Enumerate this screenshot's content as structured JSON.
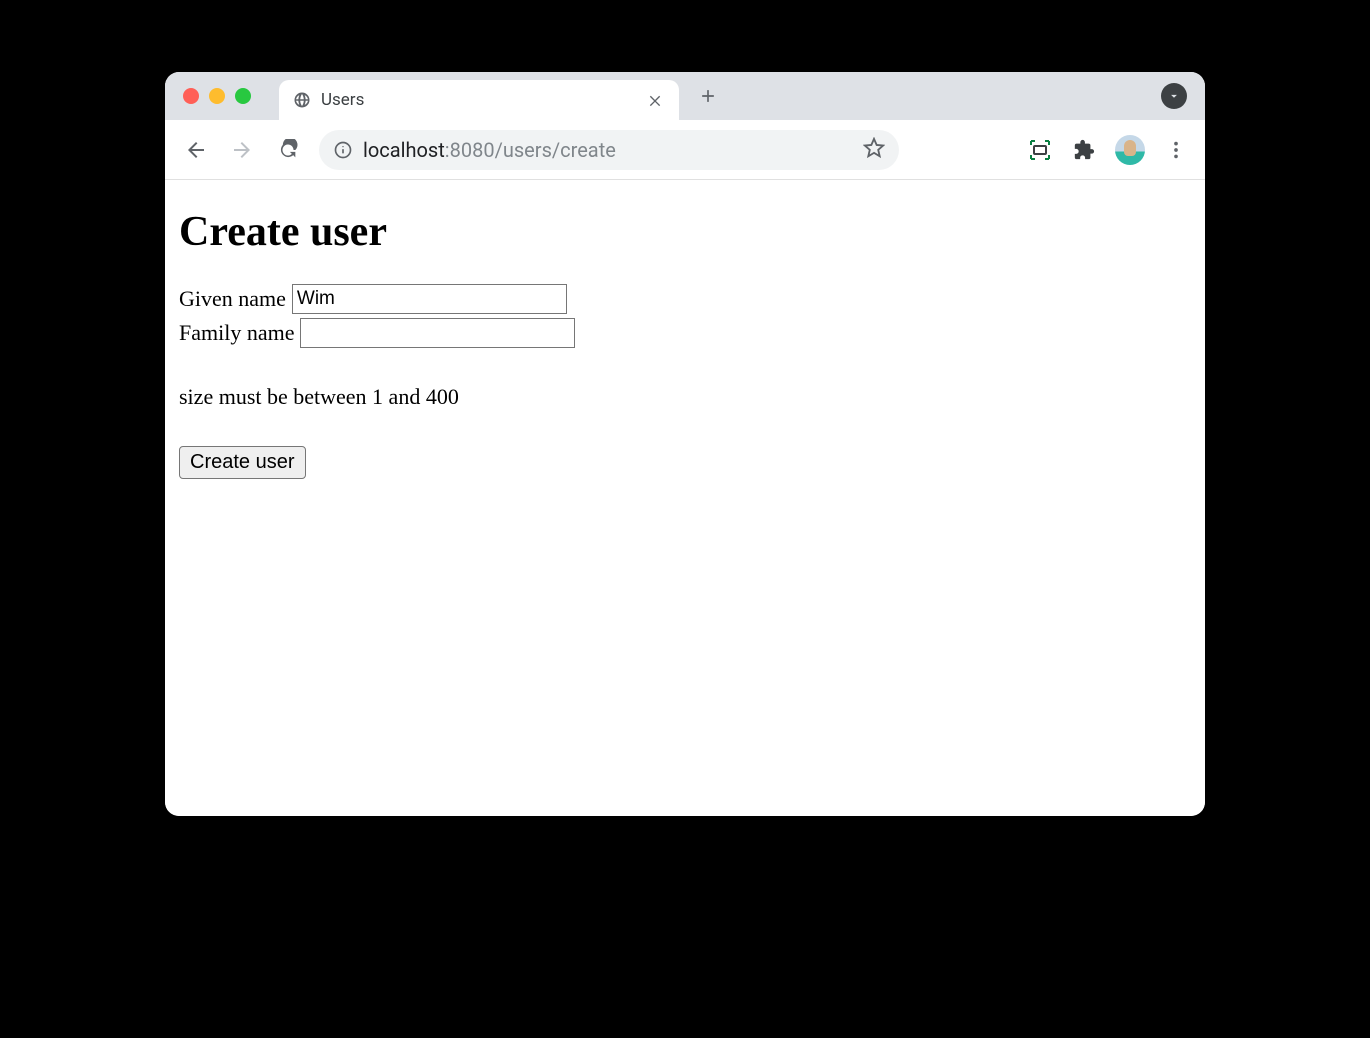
{
  "browser": {
    "tab": {
      "title": "Users"
    },
    "url": {
      "info_icon": "info",
      "host": "localhost",
      "port_path": ":8080/users/create"
    }
  },
  "page": {
    "heading": "Create user",
    "form": {
      "given_name": {
        "label": "Given name",
        "value": "Wim"
      },
      "family_name": {
        "label": "Family name",
        "value": ""
      }
    },
    "validation_message": "size must be between 1 and 400",
    "submit_label": "Create user"
  }
}
